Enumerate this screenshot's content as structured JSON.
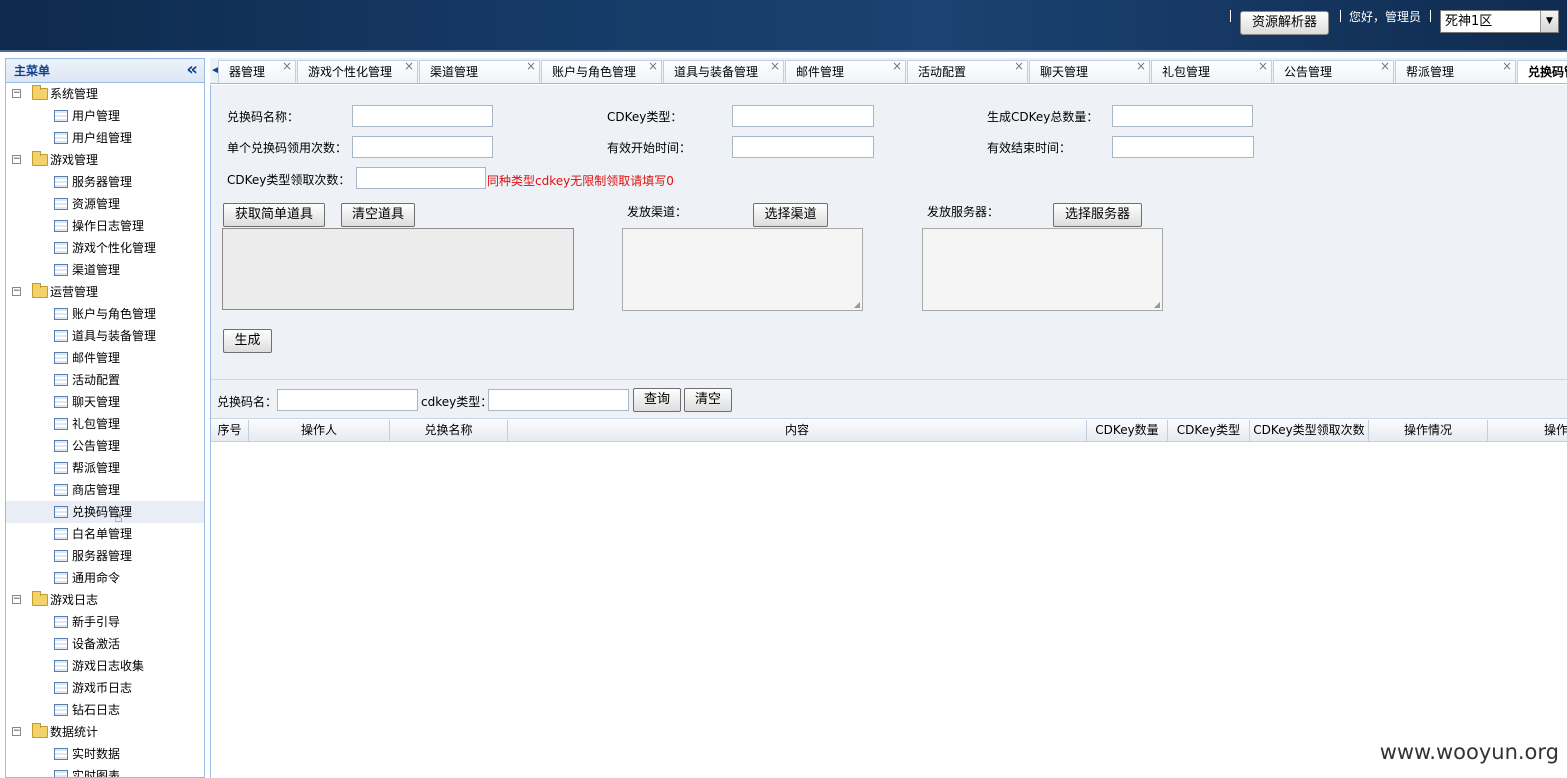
{
  "header": {
    "resource_button": "资源解析器",
    "greeting": "您好，管理员",
    "server_select": "死神1区"
  },
  "sidebar": {
    "title": "主菜单",
    "groups": [
      {
        "label": "系统管理",
        "items": [
          "用户管理",
          "用户组管理"
        ]
      },
      {
        "label": "游戏管理",
        "items": [
          "服务器管理",
          "资源管理",
          "操作日志管理",
          "游戏个性化管理",
          "渠道管理"
        ]
      },
      {
        "label": "运营管理",
        "items": [
          "账户与角色管理",
          "道具与装备管理",
          "邮件管理",
          "活动配置",
          "聊天管理",
          "礼包管理",
          "公告管理",
          "帮派管理",
          "商店管理",
          "兑换码管理",
          "白名单管理",
          "服务器管理",
          "通用命令"
        ]
      },
      {
        "label": "游戏日志",
        "items": [
          "新手引导",
          "设备激活",
          "游戏日志收集",
          "游戏币日志",
          "钻石日志"
        ]
      },
      {
        "label": "数据统计",
        "items": [
          "实时数据",
          "实时图表"
        ]
      }
    ]
  },
  "tabs": [
    "器管理",
    "游戏个性化管理",
    "渠道管理",
    "账户与角色管理",
    "道具与装备管理",
    "邮件管理",
    "活动配置",
    "聊天管理",
    "礼包管理",
    "公告管理",
    "帮派管理",
    "兑换码管理"
  ],
  "form": {
    "name_label": "兑换码名称：",
    "type_label": "CDKey类型：",
    "total_label": "生成CDKey总数量：",
    "single_use_label": "单个兑换码领用次数：",
    "start_label": "有效开始时间：",
    "end_label": "有效结束时间：",
    "type_times_label": "CDKey类型领取次数：",
    "type_times_hint": "同种类型cdkey无限制领取请填写0",
    "get_items_button": "获取简单道具",
    "clear_items_button": "清空道具",
    "channel_label": "发放渠道：",
    "select_channel_button": "选择渠道",
    "server_label": "发放服务器：",
    "select_server_button": "选择服务器",
    "generate_button": "生成"
  },
  "search": {
    "name_label": "兑换码名：",
    "type_label": "cdkey类型：",
    "query_button": "查询",
    "clear_button": "清空"
  },
  "table": {
    "columns": [
      "序号",
      "操作人",
      "兑换名称",
      "内容",
      "CDKey数量",
      "CDKey类型",
      "CDKey类型领取次数",
      "操作情况",
      "操作"
    ]
  },
  "watermark": "www.wooyun.org"
}
